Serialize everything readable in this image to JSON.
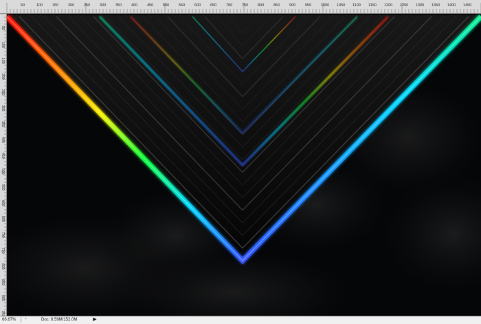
{
  "app": {
    "name": "Photoshop document window"
  },
  "rulers": {
    "top_labels": [
      "50",
      "100",
      "150",
      "200",
      "250",
      "300",
      "350",
      "400",
      "450",
      "500",
      "550",
      "600",
      "650",
      "700",
      "750",
      "800",
      "850",
      "900",
      "950",
      "1000",
      "1050",
      "1100",
      "1150",
      "1200",
      "1250",
      "1300",
      "1350",
      "1400",
      "1450"
    ],
    "left_labels": [
      "50",
      "100",
      "150",
      "200",
      "250",
      "300",
      "350",
      "400",
      "450",
      "500",
      "550",
      "600",
      "650",
      "700",
      "750",
      "800",
      "850",
      "900",
      "950"
    ]
  },
  "status": {
    "zoom": "66.67%",
    "doc": "Doc: 6.59M/152.0M",
    "icon": "document-status-icon",
    "arrow": "triangle-right-icon"
  },
  "canvas": {
    "background": "#050608",
    "artwork": "neon-rainbow-v-shape"
  },
  "colors": {
    "ui_bg": "#bdbdbd",
    "ruler_bg": "#dadada",
    "ruler_line": "#8d8d8d",
    "status_bg": "#f0f0f0",
    "canvas_bg": "#050608",
    "red": "#ff1010",
    "orange": "#ff7b00",
    "yellow": "#f7f000",
    "green": "#10ff32",
    "cyan": "#00d6ff",
    "blue": "#2962ff",
    "violet": "#b128ff",
    "magenta": "#ff36d8"
  }
}
